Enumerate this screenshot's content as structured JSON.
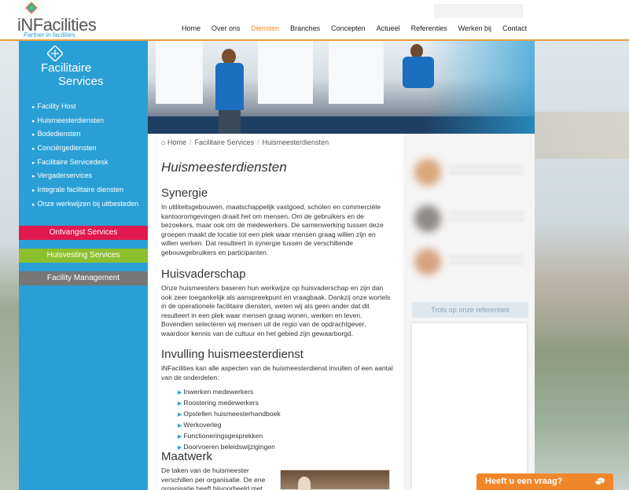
{
  "header": {
    "logo_text": "iNFacilities",
    "logo_tagline": "Partner in facilities",
    "nav": [
      "Home",
      "Over ons",
      "Diensten",
      "Branches",
      "Concepten",
      "Actueel",
      "Referenties",
      "Werken bij",
      "Contact"
    ],
    "nav_active": "Diensten"
  },
  "sidebar": {
    "title_line1": "Facilitaire",
    "title_line2": "Services",
    "items": [
      "Facility Host",
      "Huismeesterdiensten",
      "Bodediensten",
      "Conciërgediensten",
      "Facilitaire Servicedesk",
      "Vergaderservices",
      "Integrale facilitaire diensten",
      "Onze werkwijzen bij uitbesteden"
    ],
    "buttons": [
      "Ontvangst Services",
      "Huisvesting Services",
      "Facility Management"
    ]
  },
  "breadcrumb": {
    "home": "Home",
    "level1": "Facilitaire Services",
    "level2": "Huismeesterdiensten"
  },
  "main": {
    "title": "Huismeesterdiensten",
    "sections": [
      {
        "heading": "Synergie",
        "text": "In utiliteitsgebouwen, maatschappelijk vastgoed, scholen en commerciële kantooromgevingen draait het om mensen. Om de gebruikers en de bezoekers, maar ook om de medewerkers. De samenwerking tussen deze groepen maakt de locatie tot een plek waar mensen graag willen zijn en willen werken. Dat resulteert in synergie tussen de verschillende gebouwgebruikers en participanten."
      },
      {
        "heading": "Huisvaderschap",
        "text": "Onze huismeesters baseren hun werkwijze op huisvaderschap en zijn dan ook zeer toegankelijk als aanspreekpunt en vraagbaak. Dankzij onze wortels in de operationele facilitaire diensten, weten wij als geen ander dat dit resulteert in een plek waar mensen graag wonen, werken en leven. Bovendien  selecteren wij mensen uit de regio van de opdrachtgever, waardoor kennis van de cultuur en het gebied zijn gewaarborgd."
      },
      {
        "heading": "Invulling huismeesterdienst",
        "text": "iNFacilities kan alle aspecten van de huismeesterdienst invullen of een aantal van de onderdelen:",
        "bullets": [
          "Inwerken medewerkers",
          "Roostering medewerkers",
          "Opstellen huismeesterhandboek",
          "Werkoverleg",
          "Functioneringsgesprekken",
          "Doorvoeren beleidswijzigingen"
        ]
      },
      {
        "heading": "Maatwerk",
        "text": "De taken van de huismeester verschillen per organisatie. De ene organisatie heeft bijvoorbeeld met"
      }
    ]
  },
  "right": {
    "referenties_label": "Trots op onze referenties"
  },
  "chat": {
    "label": "Heeft u een vraag?"
  },
  "colors": {
    "brand_blue": "#2a9fd6",
    "nav_active": "#f08a2a",
    "btn_red": "#e1184d",
    "btn_green": "#8bbf2d",
    "btn_grey": "#777777",
    "chat_orange": "#f0862a"
  }
}
